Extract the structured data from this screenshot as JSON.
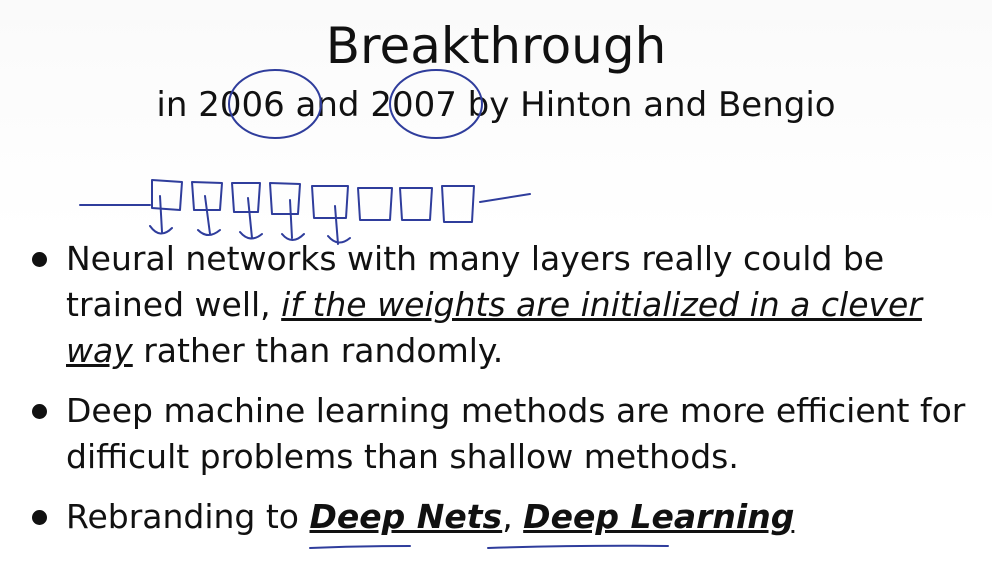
{
  "slide": {
    "title": "Breakthrough",
    "subtitle": {
      "prefix": "in ",
      "year1": "2006",
      "mid": " and ",
      "year2": "2007",
      "suffix": " by Hinton and Bengio"
    },
    "bullets": [
      {
        "part1": "Neural networks with many layers really could be trained well, ",
        "emphasis": "if the weights are initialized in a clever way",
        "part2": " rather than randomly."
      },
      {
        "text": "Deep machine learning methods are more efficient for difficult problems than shallow methods."
      },
      {
        "prefix": "Rebranding to ",
        "term1": "Deep Nets",
        "sep": ", ",
        "term2": "Deep Learning"
      }
    ]
  },
  "annotations": {
    "ink_color": "#2f3d9c"
  }
}
